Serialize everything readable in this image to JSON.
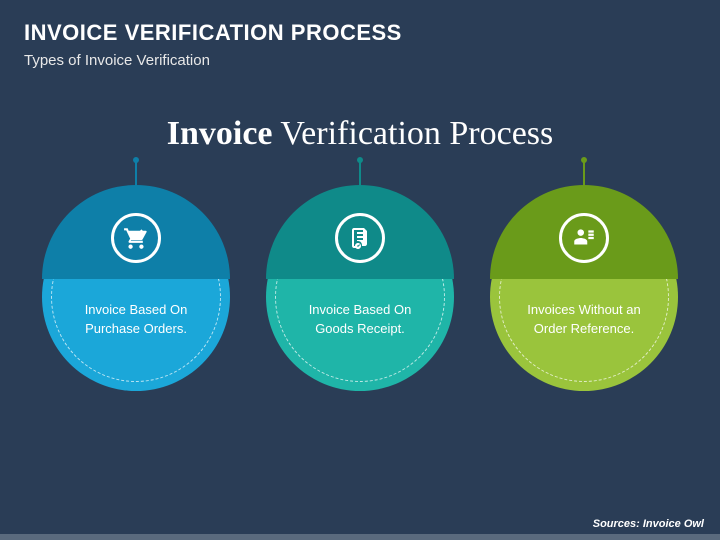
{
  "header": {
    "title": "INVOICE VERIFICATION PROCESS",
    "subtitle": "Types of Invoice Verification"
  },
  "main_title": {
    "bold": "Invoice",
    "rest": " Verification Process"
  },
  "items": [
    {
      "label": "Invoice Based On Purchase Orders.",
      "icon": "cart-check-icon"
    },
    {
      "label": "Invoice Based On Goods Receipt.",
      "icon": "receipt-check-icon"
    },
    {
      "label": "Invoices Without an Order Reference.",
      "icon": "person-doc-icon"
    }
  ],
  "footer": "Sources: Invoice Owl"
}
